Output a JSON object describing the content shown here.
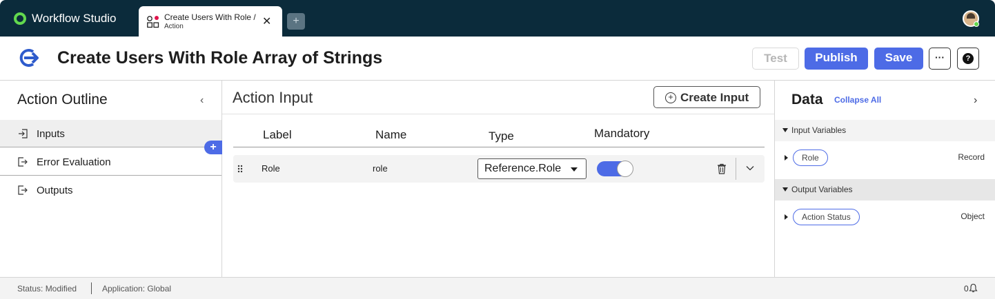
{
  "topbar": {
    "brand": "Workflow Studio",
    "tab_title": "Create Users With Role /",
    "tab_subtitle": "Action",
    "add_tab": "+"
  },
  "header": {
    "title": "Create Users With Role Array of Strings",
    "test_label": "Test",
    "publish_label": "Publish",
    "save_label": "Save",
    "more_label": "···",
    "help_label": "?"
  },
  "outline": {
    "title": "Action Outline",
    "items": [
      {
        "label": "Inputs"
      },
      {
        "label": "Error Evaluation"
      },
      {
        "label": "Outputs"
      }
    ],
    "add_label": "+"
  },
  "action_input": {
    "title": "Action Input",
    "create_label": "Create Input",
    "columns": {
      "label": "Label",
      "name": "Name",
      "type": "Type",
      "mandatory": "Mandatory"
    },
    "rows": [
      {
        "label": "Role",
        "name": "role",
        "type": "Reference.Role",
        "mandatory": true
      }
    ]
  },
  "data_panel": {
    "title": "Data",
    "collapse_all": "Collapse All",
    "input_section": "Input Variables",
    "output_section": "Output Variables",
    "inputs": [
      {
        "name": "Role",
        "type": "Record"
      }
    ],
    "outputs": [
      {
        "name": "Action Status",
        "type": "Object"
      }
    ]
  },
  "statusbar": {
    "status": "Status: Modified",
    "application": "Application: Global",
    "notifications": "0"
  },
  "colors": {
    "topbar": "#0b2b3b",
    "accent": "#4d6be6",
    "brand_green": "#62d84e"
  }
}
